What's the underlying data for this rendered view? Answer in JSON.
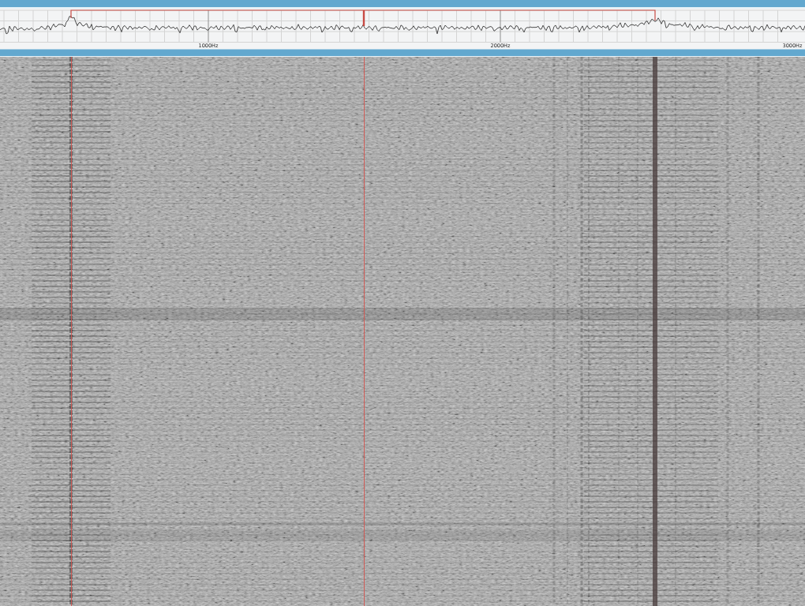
{
  "spectrum": {
    "scale_labels": [
      "1000Hz",
      "2000Hz",
      "3000Hz"
    ]
  }
}
